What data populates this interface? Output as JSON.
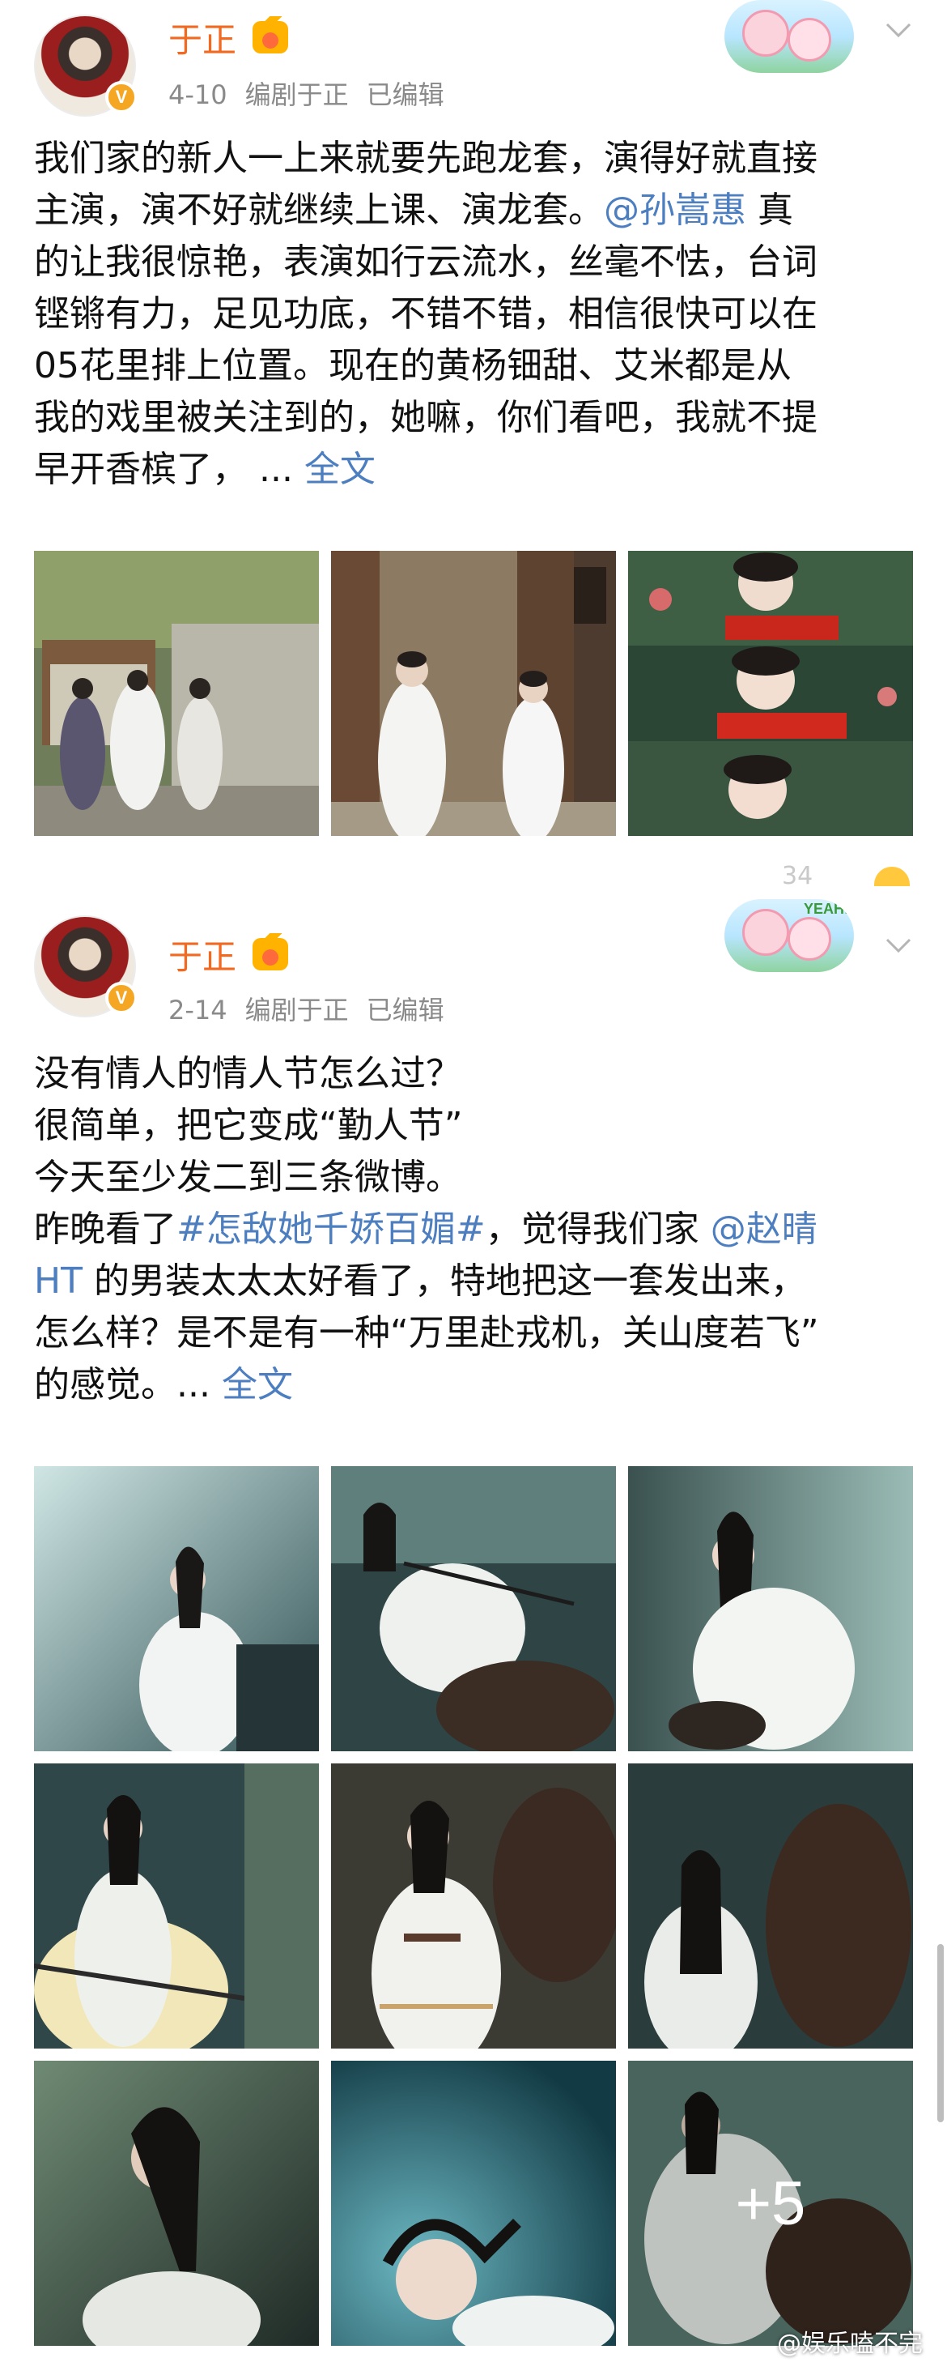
{
  "posts": [
    {
      "author": "于正",
      "date": "4-10",
      "source": "编剧于正",
      "edited": "已编辑",
      "text_lines": [
        {
          "pre": "我们家的新人一上来就要先跑龙套，演得好就直接",
          "link": "",
          "post": ""
        },
        {
          "pre": "主演，演不好就继续上课、演龙套。",
          "link": "@孙嵩惠",
          "post": " 真"
        },
        {
          "pre": "的让我很惊艳，表演如行云流水，丝毫不怯，台词",
          "link": "",
          "post": ""
        },
        {
          "pre": "铿锵有力，足见功底，不错不错，相信很快可以在",
          "link": "",
          "post": ""
        },
        {
          "pre": "05花里排上位置。现在的黄杨钿甜、艾米都是从",
          "link": "",
          "post": ""
        },
        {
          "pre": "我的戏里被关注到的，她嘛，你们看吧，我就不提",
          "link": "",
          "post": ""
        },
        {
          "pre": "早开香槟了， ... ",
          "link": "全文",
          "post": ""
        }
      ],
      "images": [
        "courtyard-scene",
        "two-in-white-robes",
        "red-scarf-faces"
      ],
      "faded_count": "34"
    },
    {
      "author": "于正",
      "date": "2-14",
      "source": "编剧于正",
      "edited": "已编辑",
      "text_lines": [
        {
          "pre": "没有情人的情人节怎么过？",
          "link": "",
          "post": ""
        },
        {
          "pre": "很简单，把它变成“勤人节”",
          "link": "",
          "post": ""
        },
        {
          "pre": "今天至少发二到三条微博。",
          "link": "",
          "post": ""
        },
        {
          "pre": "昨晚看了",
          "link": "#怎敌她千娇百媚#",
          "post": "，觉得我们家 ",
          "link2": "@赵晴"
        },
        {
          "pre": "",
          "link": "HT",
          "post": " 的男装太太太好看了，特地把这一套发出来，"
        },
        {
          "pre": "怎么样？是不是有一种“万里赴戎机，关山度若飞”",
          "link": "",
          "post": ""
        },
        {
          "pre": "的感觉。... ",
          "link": "全文",
          "post": ""
        }
      ],
      "images": [
        "rider-1",
        "rider-2",
        "rider-3",
        "rider-4",
        "rider-5",
        "rider-6",
        "rider-7",
        "rider-8",
        "rider-9"
      ],
      "more_count": "+5",
      "watermark": "@娱乐嗑不完"
    }
  ],
  "sticker_label": "YEAH!",
  "colors": {
    "name": "#f26a22",
    "link": "#4d7fc0",
    "meta": "#8a8a8a"
  }
}
